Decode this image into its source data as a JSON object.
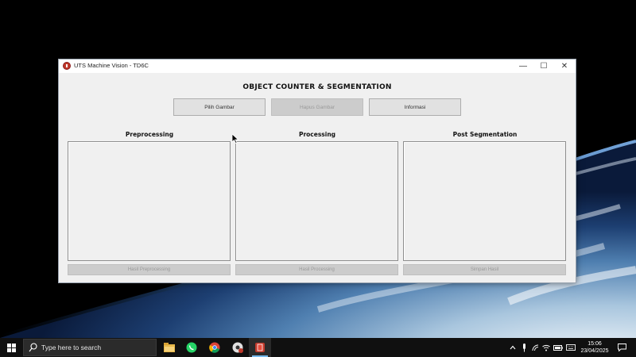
{
  "window": {
    "title": "UTS Machine Vision - TD6C",
    "controls": {
      "minimize": "—",
      "maximize": "☐",
      "close": "✕"
    }
  },
  "app": {
    "heading": "OBJECT COUNTER & SEGMENTATION",
    "top_buttons": [
      {
        "label": "Pilih Gambar",
        "enabled": true
      },
      {
        "label": "Hapus Gambar",
        "enabled": false
      },
      {
        "label": "Informasi",
        "enabled": true
      }
    ],
    "panels": [
      {
        "title": "Preprocessing",
        "button": "Hasil Preprocessing",
        "button_enabled": false
      },
      {
        "title": "Processing",
        "button": "Hasil Processing",
        "button_enabled": false
      },
      {
        "title": "Post Segmentation",
        "button": "Simpan Hasil",
        "button_enabled": false
      }
    ]
  },
  "taskbar": {
    "search_placeholder": "Type here to search",
    "pinned_apps": [
      "file-explorer-icon",
      "whatsapp-icon",
      "chrome-icon",
      "chrome-profile-icon",
      "machine-vision-app-icon"
    ],
    "tray": {
      "time": "15:06",
      "date": "23/04/2025"
    }
  },
  "colors": {
    "window_bg": "#f0f0f0",
    "taskbar_bg": "#101010",
    "app_icon": "#c0392b",
    "running_indicator": "#76b9ed"
  }
}
